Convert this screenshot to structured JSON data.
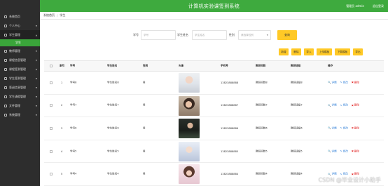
{
  "app": {
    "title": "计算机实验课签到系统",
    "user": "管理员 admin",
    "logout": "退出登录"
  },
  "colors": {
    "brand_green": "#3eaa3e",
    "sidebar": "#2d2d2d",
    "button_yellow": "#ffc926",
    "delete_red": "#e02020",
    "link_blue": "#2a7bd6"
  },
  "sidebar": {
    "items": [
      {
        "label": "系统首页",
        "icon": "home-icon"
      },
      {
        "label": "个人中心",
        "icon": "user-icon"
      },
      {
        "label": "学生管理",
        "icon": "student-icon"
      },
      {
        "label": "教师管理",
        "icon": "teacher-icon"
      },
      {
        "label": "课程信息管理",
        "icon": "course-icon"
      },
      {
        "label": "课程签到管理",
        "icon": "signin-icon"
      },
      {
        "label": "学生签到管理",
        "icon": "checkin-icon"
      },
      {
        "label": "签退信息管理",
        "icon": "signout-icon"
      },
      {
        "label": "学生请假管理",
        "icon": "leave-icon"
      },
      {
        "label": "文件管理",
        "icon": "file-icon"
      },
      {
        "label": "系统管理",
        "icon": "settings-icon"
      }
    ],
    "sub_item": "学生"
  },
  "breadcrumb": {
    "home": "系统首页",
    "separator": "/",
    "current": "学生"
  },
  "search": {
    "fields": [
      {
        "label": "学号",
        "placeholder": "学号"
      },
      {
        "label": "学生姓名",
        "placeholder": "学生姓名"
      }
    ],
    "gender": {
      "label": "性别",
      "placeholder": "请选择性别"
    },
    "button": "查询"
  },
  "actions": [
    "新增",
    "删除",
    "导入",
    "上传模板",
    "下载模板",
    "导出"
  ],
  "table": {
    "headers": {
      "index": "索引",
      "id": "学号",
      "name": "学生姓名",
      "gender": "性别",
      "photo": "头像",
      "phone": "手机号",
      "class": "教研间数",
      "major": "教研班级",
      "ops": "操作"
    },
    "rows": [
      {
        "index": "1",
        "id": "学号8",
        "name": "学生姓名8",
        "gender": "男",
        "phone": "13823888888",
        "class": "教研间数8",
        "major": "教研班级8",
        "photo": "photo-1"
      },
      {
        "index": "2",
        "id": "学号7",
        "name": "学生姓名7",
        "gender": "男",
        "phone": "13823888887",
        "class": "教研间数7",
        "major": "教研班级7",
        "photo": "photo-2"
      },
      {
        "index": "3",
        "id": "学号6",
        "name": "学生姓名6",
        "gender": "男",
        "phone": "13823888886",
        "class": "教研间数6",
        "major": "教研班级6",
        "photo": "photo-3"
      },
      {
        "index": "4",
        "id": "学号5",
        "name": "学生姓名5",
        "gender": "男",
        "phone": "13823888885",
        "class": "教研间数5",
        "major": "教研班级5",
        "photo": "photo-4"
      },
      {
        "index": "5",
        "id": "学号4",
        "name": "学生姓名4",
        "gender": "男",
        "phone": "13823888884",
        "class": "教研间数4",
        "major": "教研班级4",
        "photo": "photo-5"
      }
    ],
    "row_actions": {
      "view": "详情",
      "edit": "修改",
      "delete": "删除"
    }
  },
  "watermark": "CSDN @毕业设计小助手"
}
